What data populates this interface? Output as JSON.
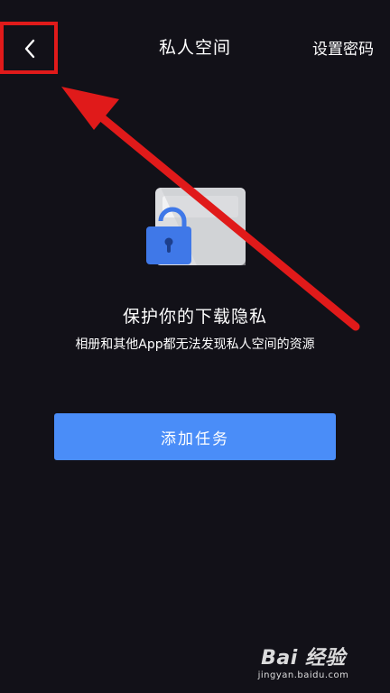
{
  "header": {
    "title": "私人空间",
    "set_password_label": "设置密码",
    "back_icon": "chevron-left-icon"
  },
  "content": {
    "illustration_icon": "lock-folder-icon",
    "headline": "保护你的下载隐私",
    "subline": "相册和其他App都无法发现私人空间的资源"
  },
  "actions": {
    "add_task_label": "添加任务"
  },
  "annotation": {
    "highlight_color": "#e01a1a",
    "arrow_color": "#e01a1a"
  },
  "watermark": {
    "logo_text": "Bai 经验",
    "url": "jingyan.baidu.com"
  },
  "colors": {
    "background": "#121118",
    "accent": "#4a8df8",
    "lock": "#3f78e8"
  }
}
